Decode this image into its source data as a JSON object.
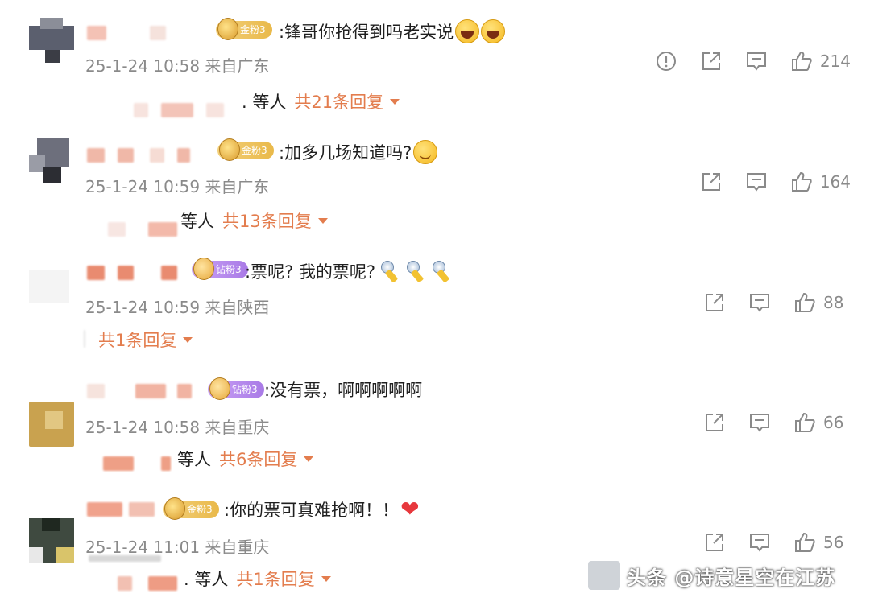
{
  "comments": [
    {
      "badge": "金粉3",
      "badge_style": "gold",
      "text": ":锋哥你抢得到吗老实说",
      "emojis": [
        "laugh",
        "laugh"
      ],
      "time": "25-1-24 10:58 来自广东",
      "likes": "214",
      "has_report": true,
      "reply_prefix": ". 等人",
      "reply_count": "共21条回复"
    },
    {
      "badge": "金粉3",
      "badge_style": "gold",
      "text": ":加多几场知道吗?",
      "emojis": [
        "smile"
      ],
      "time": "25-1-24 10:59 来自广东",
      "likes": "164",
      "has_report": false,
      "reply_prefix": "等人",
      "reply_count": "共13条回复"
    },
    {
      "badge": "钻粉3",
      "badge_style": "purple",
      "text": ":票呢? 我的票呢?",
      "emojis": [
        "mic",
        "mic",
        "mic"
      ],
      "time": "25-1-24 10:59 来自陕西",
      "likes": "88",
      "has_report": false,
      "reply_prefix": "",
      "reply_count": "共1条回复"
    },
    {
      "badge": "钻粉3",
      "badge_style": "purple",
      "text": ":没有票，啊啊啊啊啊",
      "emojis": [],
      "time": "25-1-24 10:58 来自重庆",
      "likes": "66",
      "has_report": false,
      "reply_prefix": "等人",
      "reply_count": "共6条回复"
    },
    {
      "badge": "金粉3",
      "badge_style": "gold",
      "text": ":你的票可真难抢啊！！",
      "emojis": [
        "heart"
      ],
      "time": "25-1-24 11:01 来自重庆",
      "likes": "56",
      "has_report": false,
      "reply_prefix": ". 等人",
      "reply_count": "共1条回复"
    }
  ],
  "watermark": {
    "text": "头条 @诗意星空在江苏"
  },
  "icons": {
    "report": "report-icon",
    "share": "share-icon",
    "comment": "comment-icon",
    "like": "thumbs-up-icon",
    "expand": "chevron-down-icon"
  },
  "colors": {
    "accent": "#e37d4e",
    "meta": "#8a8a8a",
    "text": "#1f1f1f"
  }
}
